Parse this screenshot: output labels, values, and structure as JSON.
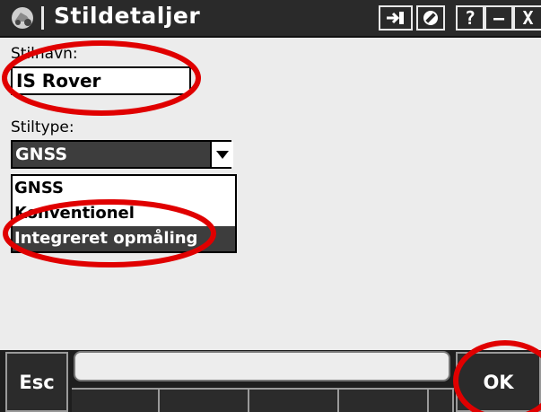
{
  "window": {
    "title": "Stildetaljer",
    "icon": "tractor-app-icon",
    "buttons": [
      {
        "name": "login-arrow-icon",
        "label": ""
      },
      {
        "name": "no-entry-icon",
        "label": ""
      },
      {
        "name": "help-button",
        "label": "?"
      },
      {
        "name": "minimize-button",
        "label": "–"
      },
      {
        "name": "close-button",
        "label": "X"
      }
    ]
  },
  "form": {
    "style_name_label": "Stilnavn:",
    "style_name_value": "IS Rover",
    "style_type_label": "Stiltype:",
    "style_type_value": "GNSS",
    "options": [
      "GNSS",
      "Konventionel",
      "Integreret opmåling"
    ],
    "highlighted_option": "Integreret opmåling"
  },
  "softkeys": {
    "esc": "Esc",
    "ok": "OK"
  },
  "colors": {
    "titlebar": "#2a2a2a",
    "selection": "#3d3d3d",
    "annotation": "#e00000"
  }
}
